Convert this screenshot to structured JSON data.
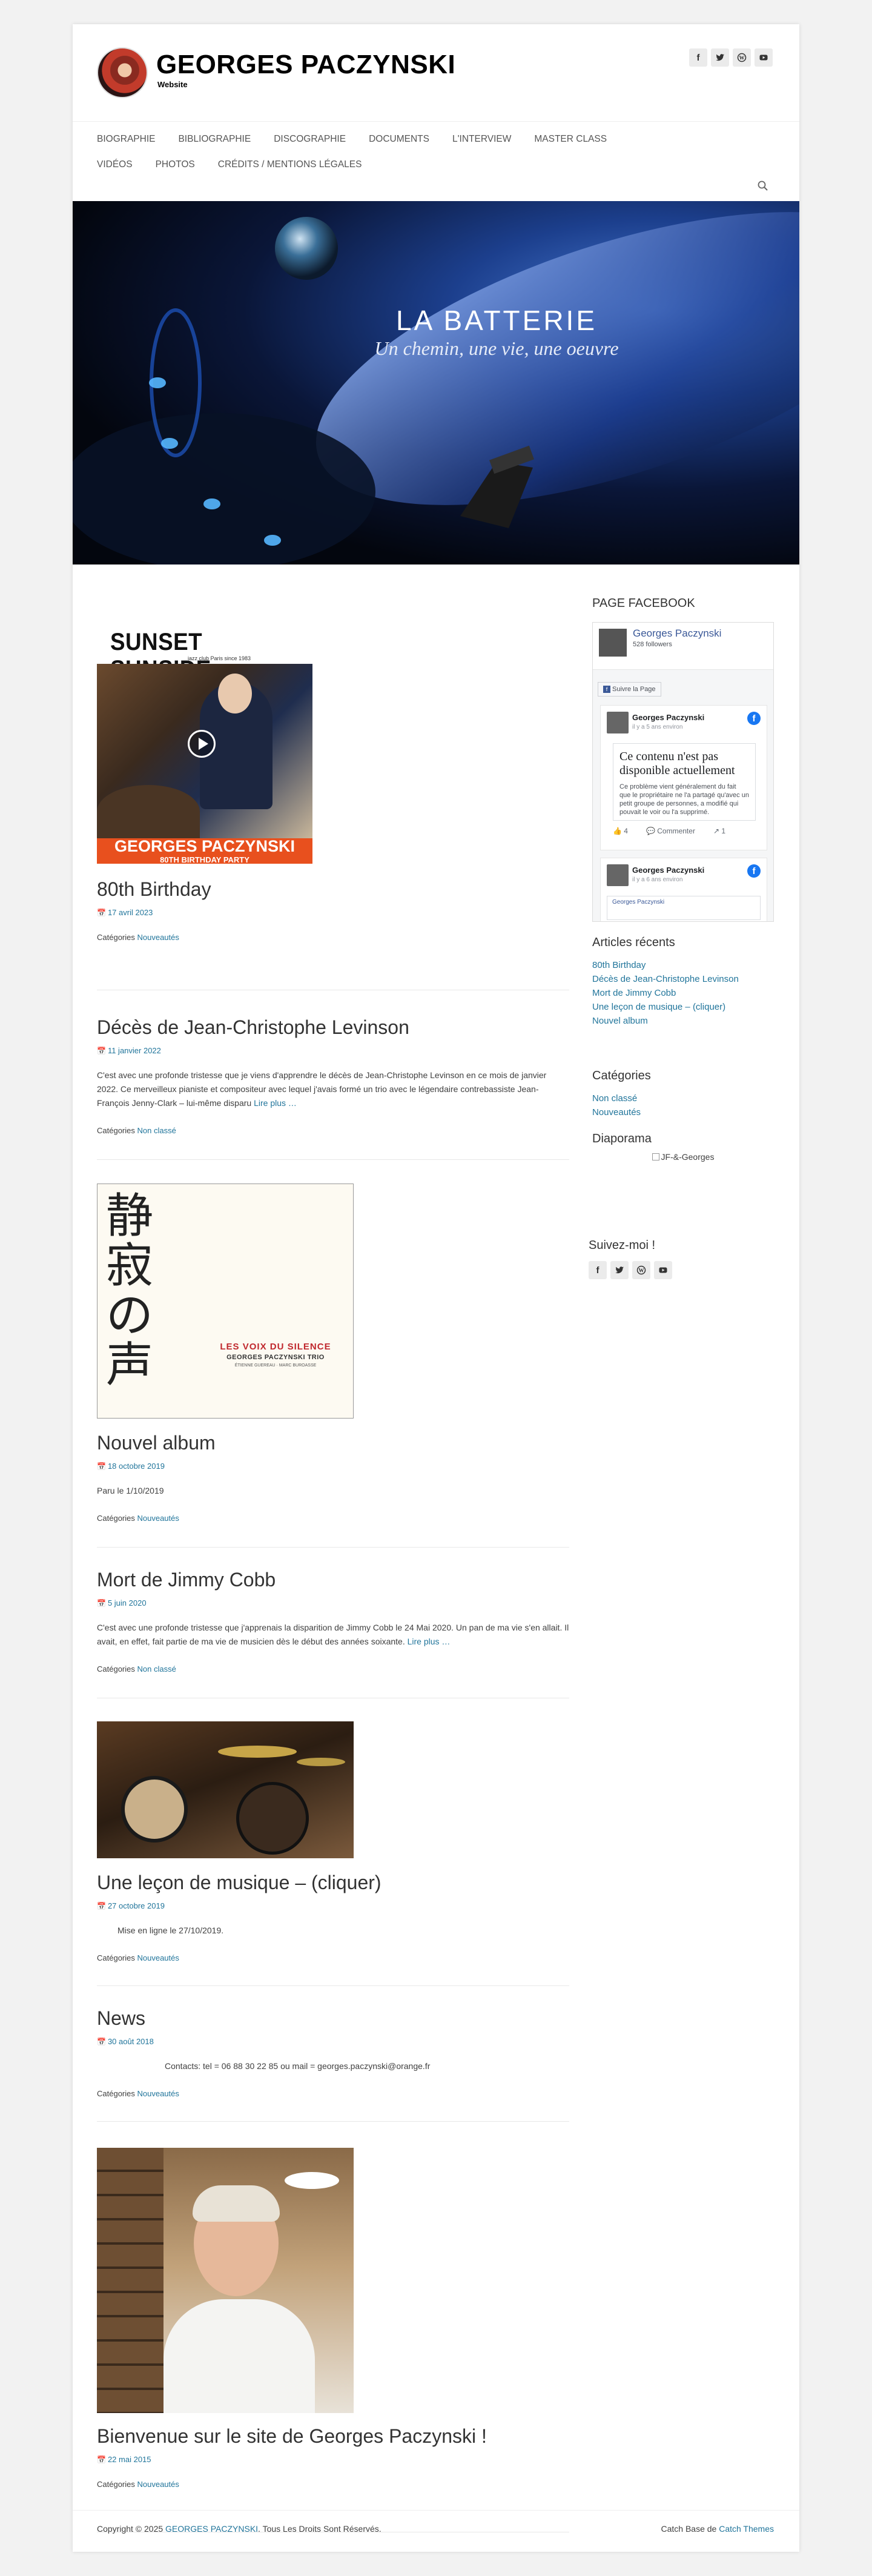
{
  "header": {
    "title": "GEORGES PACZYNSKI",
    "description": "Website"
  },
  "nav": {
    "items": [
      "BIOGRAPHIE",
      "BIBLIOGRAPHIE",
      "DISCOGRAPHIE",
      "DOCUMENTS",
      "L'INTERVIEW",
      "MASTER CLASS",
      "VIDÉOS",
      "PHOTOS",
      "CRÉDITS / MENTIONS LÉGALES"
    ]
  },
  "banner": {
    "line1": "LA BATTERIE",
    "line2": "Un chemin, une vie, une oeuvre"
  },
  "posts": [
    {
      "title": "80th Birthday",
      "date": "17 avril 2023",
      "categories_label": "Catégories",
      "category": "Nouveautés",
      "image": {
        "header": "SUNSET SUNSIDE",
        "subheader": "jazz club Paris since 1983",
        "name": "GEORGES PACZYNSKI",
        "event": "80TH BIRTHDAY PARTY"
      }
    },
    {
      "title": "Décès de Jean-Christophe Levinson",
      "date": "11 janvier 2022",
      "excerpt": "C'est avec une profonde tristesse que je viens d'apprendre le décès de Jean-Christophe Levinson en ce mois de janvier 2022. Ce merveilleux pianiste et compositeur avec lequel j'avais formé un trio avec le légendaire contrebassiste Jean-François Jenny-Clark – lui-même disparu",
      "read_more": "Lire plus …",
      "categories_label": "Catégories",
      "category": "Non classé"
    },
    {
      "title": "Nouvel album",
      "date": "18 octobre 2019",
      "excerpt": "Paru le 1/10/2019",
      "categories_label": "Catégories",
      "category": "Nouveautés",
      "image": {
        "kanji": [
          "静",
          "寂",
          "の",
          "声"
        ],
        "album": "LES VOIX DU SILENCE",
        "trio": "GEORGES PACZYNSKI TRIO",
        "members": "ÉTIENNE GUEREAU · MARC BUROASSE"
      }
    },
    {
      "title": "Mort de Jimmy Cobb",
      "date": "5 juin 2020",
      "excerpt": "C'est avec une profonde tristesse que j'apprenais la disparition de Jimmy Cobb le 24 Mai 2020. Un pan de ma vie s'en allait. Il avait, en effet, fait partie de ma vie de musicien dès le début des années soixante.",
      "read_more": "Lire plus …",
      "categories_label": "Catégories",
      "category": "Non classé"
    },
    {
      "title": "Une leçon de musique – (cliquer)",
      "date": "27 octobre 2019",
      "excerpt": "Mise en ligne le 27/10/2019.",
      "categories_label": "Catégories",
      "category": "Nouveautés"
    },
    {
      "title": "News",
      "date": "30 août 2018",
      "excerpt": "Contacts: tel = 06 88 30 22 85 ou mail = georges.paczynski@orange.fr",
      "categories_label": "Catégories",
      "category": "Nouveautés"
    },
    {
      "title": "Bienvenue sur le site de Georges Paczynski !",
      "date": "22 mai 2015",
      "categories_label": "Catégories",
      "category": "Nouveautés"
    }
  ],
  "sidebar": {
    "facebook_title": "PAGE FACEBOOK",
    "fb_page_name": "Georges Paczynski",
    "fb_followers": "528 followers",
    "fb_like_button": "Suivre la Page",
    "fb_post_author": "Georges Paczynski",
    "fb_post_time": "il y a 5 ans environ",
    "fb_post_time2": "il y a 6 ans environ",
    "fb_unavailable_title": "Ce contenu n'est pas disponible actuellement",
    "fb_unavailable_body": "Ce problème vient généralement du fait que le propriétaire ne l'a partagé qu'avec un petit groupe de personnes, a modifié qui pouvait le voir ou l'a supprimé.",
    "fb_likes": "4",
    "fb_comment": "Commenter",
    "fb_share": "1",
    "fb_bottom_link": "Georges Paczynski",
    "recent_title": "Articles récents",
    "recent": [
      "80th Birthday",
      "Décès de Jean-Christophe Levinson",
      "Mort de Jimmy Cobb",
      "Une leçon de musique – (cliquer)",
      "Nouvel album"
    ],
    "categories_title": "Catégories",
    "categories": [
      "Non classé",
      "Nouveautés"
    ],
    "diaporama_title": "Diaporama",
    "diaporama_alt": "JF-&-Georges",
    "follow_title": "Suivez-moi !"
  },
  "footer": {
    "copyright_prefix": "Copyright © 2025",
    "site_link": "GEORGES PACZYNSKI",
    "rights": ". Tous Les Droits Sont Réservés.",
    "theme_prefix": "Catch Base de",
    "theme_link": "Catch Themes"
  },
  "colors": {
    "link": "#21759b",
    "fb_blue": "#1877f2",
    "orange_banner": "#e8501e"
  },
  "icons": [
    "facebook-icon",
    "twitter-icon",
    "wordpress-icon",
    "youtube-icon",
    "search-icon",
    "calendar-icon"
  ]
}
